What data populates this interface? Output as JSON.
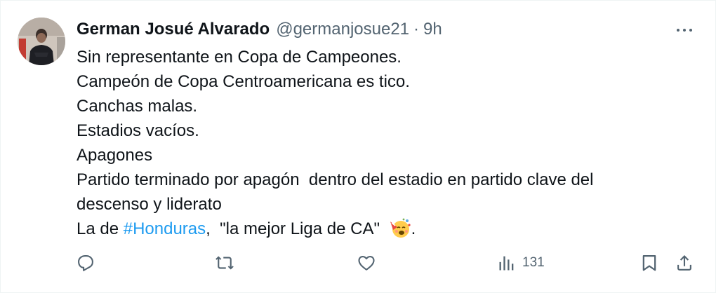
{
  "tweet": {
    "author_name": "German Josué Alvarado",
    "handle": "@germanjosue21",
    "separator": "·",
    "time": "9h",
    "lines": [
      "Sin representante en Copa de Campeones.",
      "Campeón de Copa Centroamericana es tico.",
      "Canchas malas.",
      "Estadios vacíos.",
      "Apagones",
      "Partido terminado por apagón  dentro del estadio en partido clave del",
      "descenso y liderato"
    ],
    "last_line": {
      "prefix": "La de ",
      "hashtag": "#Honduras",
      "middle": ",  \"la mejor Liga de CA\" ",
      "suffix": "."
    },
    "emoji": "face-with-party-horn-icon"
  },
  "actions": {
    "reply_icon": "reply-icon",
    "retweet_icon": "retweet-icon",
    "like_icon": "like-icon",
    "views_icon": "views-icon",
    "views_count": "131",
    "bookmark_icon": "bookmark-icon",
    "share_icon": "share-icon"
  },
  "colors": {
    "text": "#0f1419",
    "secondary": "#536471",
    "link": "#1d9bf0"
  }
}
